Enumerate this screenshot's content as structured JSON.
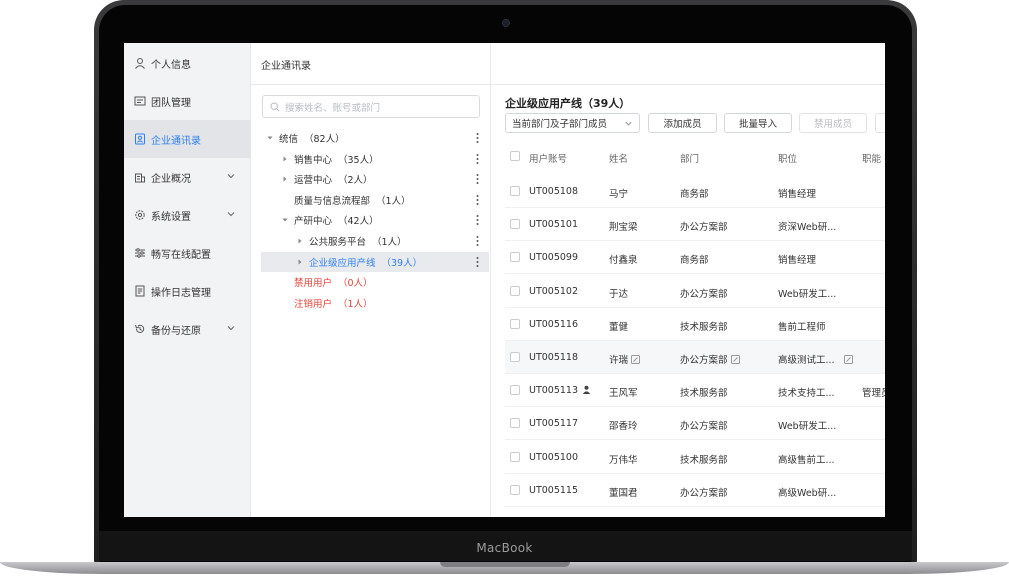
{
  "device": {
    "brand": "MacBook"
  },
  "nav": {
    "items": [
      {
        "label": "个人信息",
        "icon": "person-icon",
        "active": false,
        "expandable": false
      },
      {
        "label": "团队管理",
        "icon": "team-icon",
        "active": false,
        "expandable": false
      },
      {
        "label": "企业通讯录",
        "icon": "contacts-icon",
        "active": true,
        "expandable": false
      },
      {
        "label": "企业概况",
        "icon": "building-icon",
        "active": false,
        "expandable": true
      },
      {
        "label": "系统设置",
        "icon": "gear-icon",
        "active": false,
        "expandable": true
      },
      {
        "label": "畅写在线配置",
        "icon": "sliders-icon",
        "active": false,
        "expandable": false
      },
      {
        "label": "操作日志管理",
        "icon": "log-icon",
        "active": false,
        "expandable": false
      },
      {
        "label": "备份与还原",
        "icon": "restore-icon",
        "active": false,
        "expandable": true
      }
    ]
  },
  "breadcrumb": "企业通讯录",
  "search": {
    "placeholder": "搜索姓名、账号或部门"
  },
  "tree": [
    {
      "name": "统信",
      "count": "（82人）",
      "level": 0,
      "toggle": "open",
      "style": "normal"
    },
    {
      "name": "销售中心",
      "count": "（35人）",
      "level": 1,
      "toggle": "closed",
      "style": "normal"
    },
    {
      "name": "运营中心",
      "count": "（2人）",
      "level": 1,
      "toggle": "closed",
      "style": "normal"
    },
    {
      "name": "质量与信息流程部",
      "count": "（1人）",
      "level": 1,
      "toggle": "none",
      "style": "normal"
    },
    {
      "name": "产研中心",
      "count": "（42人）",
      "level": 1,
      "toggle": "open",
      "style": "normal"
    },
    {
      "name": "公共服务平台",
      "count": "（1人）",
      "level": 2,
      "toggle": "closed",
      "style": "normal"
    },
    {
      "name": "企业级应用产线",
      "count": "（39人）",
      "level": 2,
      "toggle": "closed",
      "style": "selected"
    },
    {
      "name": "禁用用户",
      "count": "（0人）",
      "level": 1,
      "toggle": "none",
      "style": "red"
    },
    {
      "name": "注销用户",
      "count": "（1人）",
      "level": 1,
      "toggle": "none",
      "style": "red"
    }
  ],
  "department": {
    "title": "企业级应用产线（39人）",
    "scope_select": "当前部门及子部门成员",
    "buttons": {
      "add": "添加成员",
      "import": "批量导入",
      "disable": "禁用成员"
    }
  },
  "table": {
    "columns": [
      "用户账号",
      "姓名",
      "部门",
      "职位",
      "职能"
    ],
    "rows": [
      {
        "account": "UT005108",
        "name": "马宁",
        "dept": "商务部",
        "title": "销售经理",
        "func": "",
        "admin": false,
        "hover": false
      },
      {
        "account": "UT005101",
        "name": "荆宝梁",
        "dept": "办公方案部",
        "title": "资深Web研...",
        "func": "",
        "admin": false,
        "hover": false
      },
      {
        "account": "UT005099",
        "name": "付鑫泉",
        "dept": "商务部",
        "title": "销售经理",
        "func": "",
        "admin": false,
        "hover": false
      },
      {
        "account": "UT005102",
        "name": "于达",
        "dept": "办公方案部",
        "title": "Web研发工...",
        "func": "",
        "admin": false,
        "hover": false
      },
      {
        "account": "UT005116",
        "name": "董健",
        "dept": "技术服务部",
        "title": "售前工程师",
        "func": "",
        "admin": false,
        "hover": false
      },
      {
        "account": "UT005118",
        "name": "许瑞",
        "dept": "办公方案部",
        "title": "高级测试工...",
        "func": "",
        "admin": false,
        "hover": true
      },
      {
        "account": "UT005113",
        "name": "王风军",
        "dept": "技术服务部",
        "title": "技术支持工...",
        "func": "管理员",
        "admin": true,
        "hover": false
      },
      {
        "account": "UT005117",
        "name": "邵香玲",
        "dept": "办公方案部",
        "title": "Web研发工...",
        "func": "",
        "admin": false,
        "hover": false
      },
      {
        "account": "UT005100",
        "name": "万伟华",
        "dept": "技术服务部",
        "title": "高级售前工...",
        "func": "",
        "admin": false,
        "hover": false
      },
      {
        "account": "UT005115",
        "name": "董国君",
        "dept": "办公方案部",
        "title": "高级Web研...",
        "func": "",
        "admin": false,
        "hover": false
      }
    ]
  },
  "colors": {
    "accent": "#2f7ff0",
    "danger": "#e5413a",
    "nav_bg": "#f2f3f5"
  }
}
